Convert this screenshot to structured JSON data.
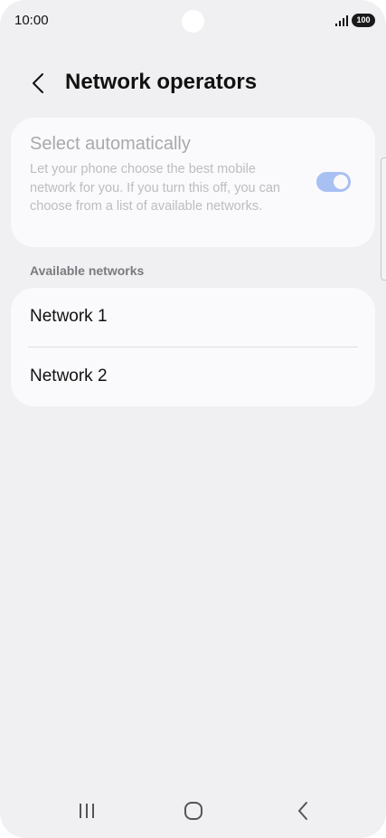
{
  "status_bar": {
    "time": "10:00",
    "battery": "100",
    "icons": [
      "signal-icon",
      "battery-icon"
    ]
  },
  "header": {
    "back_icon": "chevron-left-icon",
    "title": "Network operators"
  },
  "auto_select": {
    "title": "Select automatically",
    "description": "Let your phone choose the best mobile network for you. If you turn this off, you can choose from a list of available networks.",
    "toggle_on": true,
    "toggle_color": "#a9c0f3"
  },
  "available_networks": {
    "section_label": "Available networks",
    "items": [
      {
        "label": "Network 1"
      },
      {
        "label": "Network 2"
      }
    ]
  },
  "nav_bar": {
    "icons": [
      "recents-icon",
      "home-icon",
      "back-icon"
    ]
  },
  "colors": {
    "background": "#f0f0f2",
    "card": "#fafafc",
    "text_primary": "#111111",
    "text_disabled": "#a9a9ad"
  }
}
